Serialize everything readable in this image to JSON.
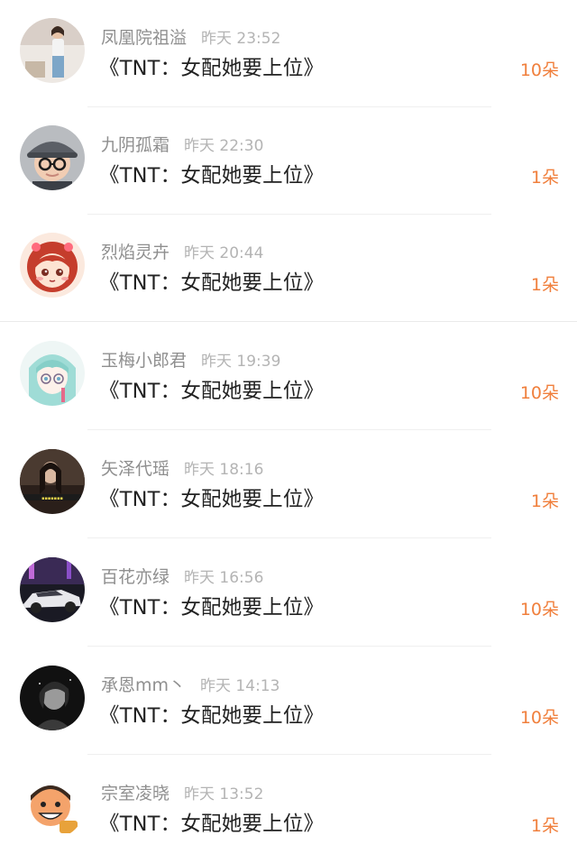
{
  "records": [
    {
      "user": "凤凰院祖溢",
      "time": "昨天 23:52",
      "title": "《TNT：女配她要上位》",
      "amount": "10朵",
      "avatar": "girl-photo-icon"
    },
    {
      "user": "九阴孤霜",
      "time": "昨天 22:30",
      "title": "《TNT：女配她要上位》",
      "amount": "1朵",
      "avatar": "boy-cap-glasses-icon"
    },
    {
      "user": "烈焰灵卉",
      "time": "昨天 20:44",
      "title": "《TNT：女配她要上位》",
      "amount": "1朵",
      "avatar": "cartoon-girl-icon"
    },
    {
      "user": "玉梅小郎君",
      "time": "昨天 19:39",
      "title": "《TNT：女配她要上位》",
      "amount": "10朵",
      "avatar": "anime-girl-icon"
    },
    {
      "user": "矢泽代瑶",
      "time": "昨天 18:16",
      "title": "《TNT：女配她要上位》",
      "amount": "1朵",
      "avatar": "dark-portrait-icon"
    },
    {
      "user": "百花亦绿",
      "time": "昨天 16:56",
      "title": "《TNT：女配她要上位》",
      "amount": "10朵",
      "avatar": "sports-car-icon"
    },
    {
      "user": "承恩mm丶",
      "time": "昨天 14:13",
      "title": "《TNT：女配她要上位》",
      "amount": "10朵",
      "avatar": "bw-portrait-icon"
    },
    {
      "user": "宗室凌晓",
      "time": "昨天 13:52",
      "title": "《TNT：女配她要上位》",
      "amount": "1朵",
      "avatar": "cartoon-boy-icon"
    }
  ],
  "colors": {
    "amount": "#f07f3c",
    "username": "#8f8f8f",
    "time": "#b4b4b4",
    "title": "#222222"
  }
}
